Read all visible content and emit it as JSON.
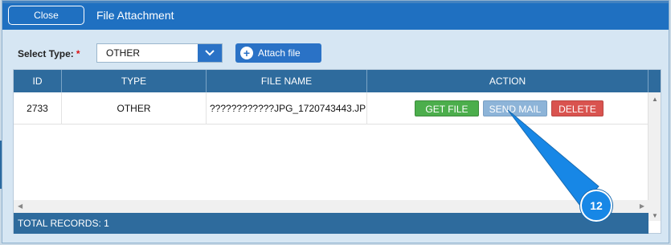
{
  "dialog": {
    "title": "File Attachment",
    "close_label": "Close"
  },
  "form": {
    "type_label": "Select Type:",
    "required_mark": "*",
    "type_value": "OTHER",
    "attach_label": "Attach file"
  },
  "grid": {
    "columns": [
      "ID",
      "TYPE",
      "FILE NAME",
      "ACTION"
    ],
    "rows": [
      {
        "id": "2733",
        "type": "OTHER",
        "file_name": "????????????JPG_1720743443.JP",
        "actions": {
          "get": "GET FILE",
          "send": "SEND MAIL",
          "delete": "DELETE"
        }
      }
    ],
    "footer": "TOTAL RECORDS: 1"
  },
  "callout": {
    "number": "12"
  },
  "colors": {
    "title_bar": "#1f70c1",
    "header": "#2e6b9d",
    "get_file": "#4cae4c",
    "send_mail": "#8db4d8",
    "delete": "#d9534f",
    "callout": "#1787e6"
  }
}
